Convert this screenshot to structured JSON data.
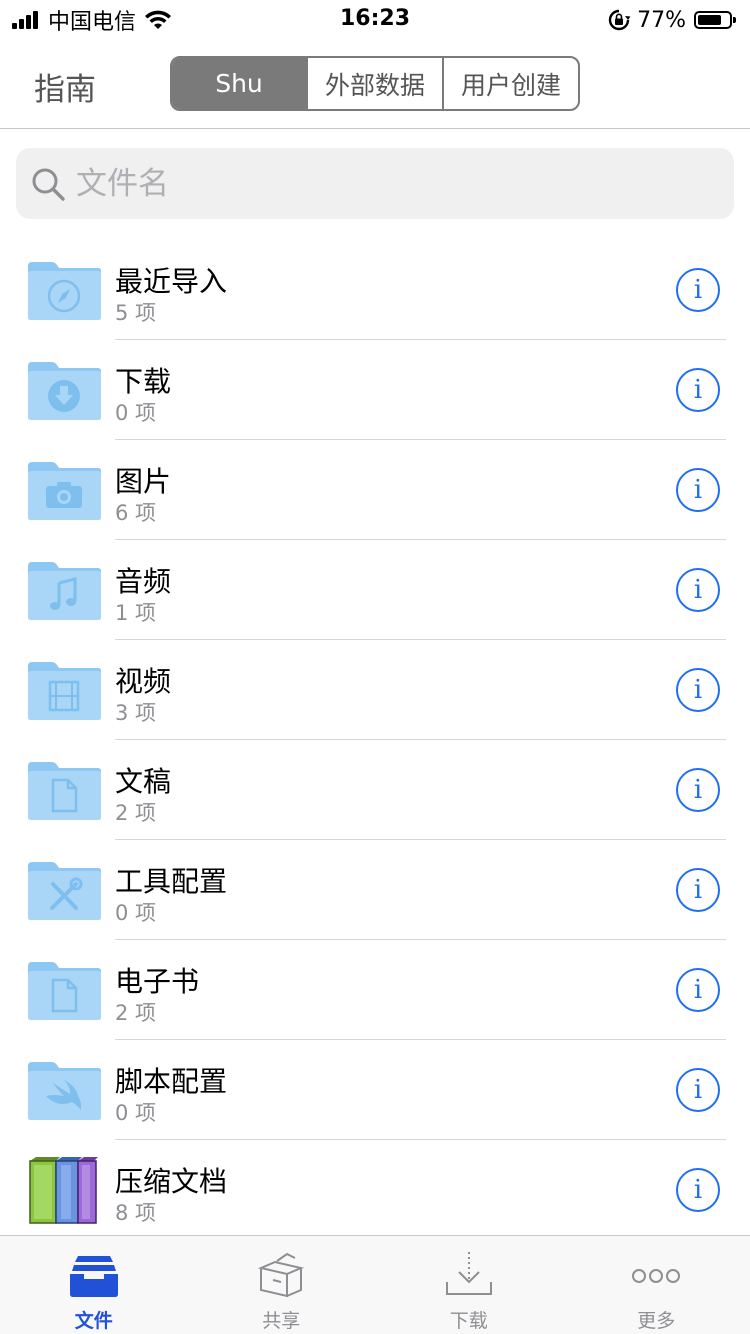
{
  "status_bar": {
    "carrier": "中国电信",
    "time": "16:23",
    "battery_percent": "77%",
    "battery_level": 0.77
  },
  "nav": {
    "title": "指南",
    "segments": [
      {
        "label": "Shu",
        "selected": true
      },
      {
        "label": "外部数据",
        "selected": false
      },
      {
        "label": "用户创建",
        "selected": false
      }
    ]
  },
  "search": {
    "placeholder": "文件名",
    "value": ""
  },
  "files": [
    {
      "name": "最近导入",
      "count": "5 项",
      "icon": "folder-compass-icon"
    },
    {
      "name": "下载",
      "count": "0 项",
      "icon": "folder-download-icon"
    },
    {
      "name": "图片",
      "count": "6 项",
      "icon": "folder-camera-icon"
    },
    {
      "name": "音频",
      "count": "1 项",
      "icon": "folder-music-icon"
    },
    {
      "name": "视频",
      "count": "3 项",
      "icon": "folder-film-icon"
    },
    {
      "name": "文稿",
      "count": "2 项",
      "icon": "folder-document-icon"
    },
    {
      "name": "工具配置",
      "count": "0 项",
      "icon": "folder-tools-icon"
    },
    {
      "name": "电子书",
      "count": "2 项",
      "icon": "folder-document-icon"
    },
    {
      "name": "脚本配置",
      "count": "0 项",
      "icon": "folder-swift-icon"
    },
    {
      "name": "压缩文档",
      "count": "8 项",
      "icon": "archive-books-icon"
    }
  ],
  "info_glyph": "i",
  "tabs": [
    {
      "label": "文件",
      "icon": "files-tray-icon",
      "active": true
    },
    {
      "label": "共享",
      "icon": "share-box-icon",
      "active": false
    },
    {
      "label": "下载",
      "icon": "download-tray-icon",
      "active": false
    },
    {
      "label": "更多",
      "icon": "more-dots-icon",
      "active": false
    }
  ],
  "colors": {
    "accent": "#1e6ef2",
    "tab_active": "#2051d6",
    "folder": "#a9d6f7",
    "folder_tab": "#8ec8f2",
    "segment_active": "#7a7a7a"
  }
}
